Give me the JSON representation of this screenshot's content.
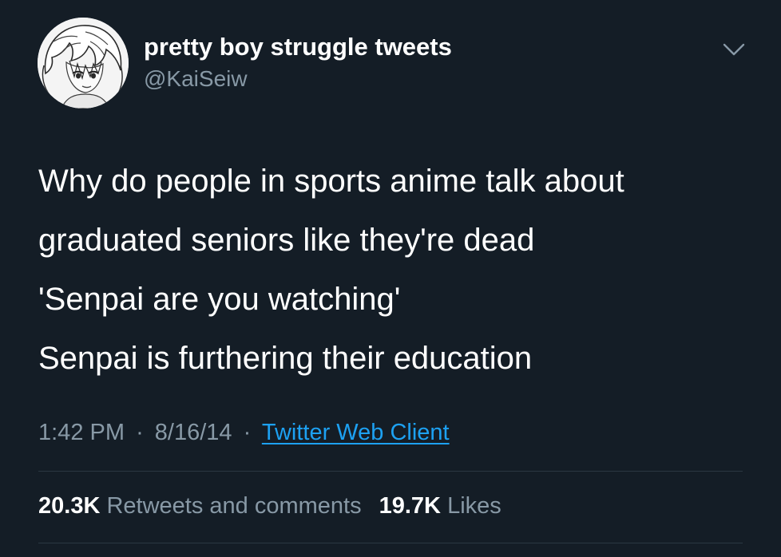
{
  "user": {
    "display_name": "pretty boy struggle tweets",
    "handle": "@KaiSeiw",
    "avatar_icon": "anime-character-avatar"
  },
  "tweet": {
    "lines": [
      "Why do people in sports anime talk about",
      "graduated seniors like they're dead",
      "'Senpai are you watching'",
      "Senpai is furthering their education"
    ]
  },
  "meta": {
    "time": "1:42 PM",
    "separator": "·",
    "date": "8/16/14",
    "source": "Twitter Web Client"
  },
  "stats": {
    "retweets_count": "20.3K",
    "retweets_label": "Retweets and comments",
    "likes_count": "19.7K",
    "likes_label": "Likes"
  },
  "colors": {
    "background": "#141d26",
    "primary_text": "#ffffff",
    "secondary_text": "#8899a6",
    "link": "#1da1f2"
  },
  "icons": {
    "menu": "chevron-down-icon"
  }
}
